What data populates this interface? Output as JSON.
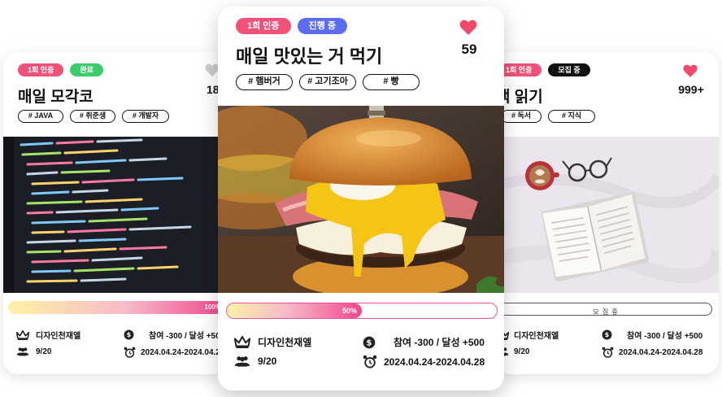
{
  "colors": {
    "pink": "#f0527a",
    "green": "#3ecb6b",
    "blue": "#5b6cf0",
    "black": "#111111",
    "heart_red": "#f2496a",
    "heart_gray": "#cccccc"
  },
  "icons": [
    "crown-icon",
    "dollar-coin-icon",
    "group-icon",
    "alarm-clock-icon",
    "heart-icon"
  ],
  "cards": {
    "left": {
      "badges": [
        "1회 인증",
        "완료"
      ],
      "title": "매일 모각코",
      "like_count": "18",
      "tags": [
        "# JAVA",
        "# 취준생",
        "# 개발자"
      ],
      "photo": "code-on-monitor",
      "progress": {
        "fraction": 1.0,
        "label": "100%"
      },
      "creator": "디자인천재엘",
      "members": "9/20",
      "reward": "참여 -300 / 달성 +500",
      "period": "2024.04.24-2024.04.28"
    },
    "center": {
      "badges": [
        "1회 인증",
        "진행 중"
      ],
      "title": "매일 맛있는 거 먹기",
      "like_count": "59",
      "tags": [
        "# 햄버거",
        "# 고기조아",
        "# 빵"
      ],
      "photo": "burger",
      "progress": {
        "fraction": 0.5,
        "label": "50%"
      },
      "creator": "디자인천재엘",
      "members": "9/20",
      "reward": "참여 -300 / 달성 +500",
      "period": "2024.04.24-2024.04.28"
    },
    "right": {
      "badges": [
        "1회 인증",
        "모집 중"
      ],
      "title": "책 읽기",
      "like_count": "999+",
      "tags": [
        "# 독서",
        "# 지식"
      ],
      "photo": "book-and-coffee",
      "progress": {
        "fraction": 0,
        "label": "모 집 중"
      },
      "creator": "디자인천재엘",
      "members": "9/20",
      "reward": "참여 -300 / 달성 +500",
      "period": "2024.04.24-2024.04.28"
    }
  }
}
